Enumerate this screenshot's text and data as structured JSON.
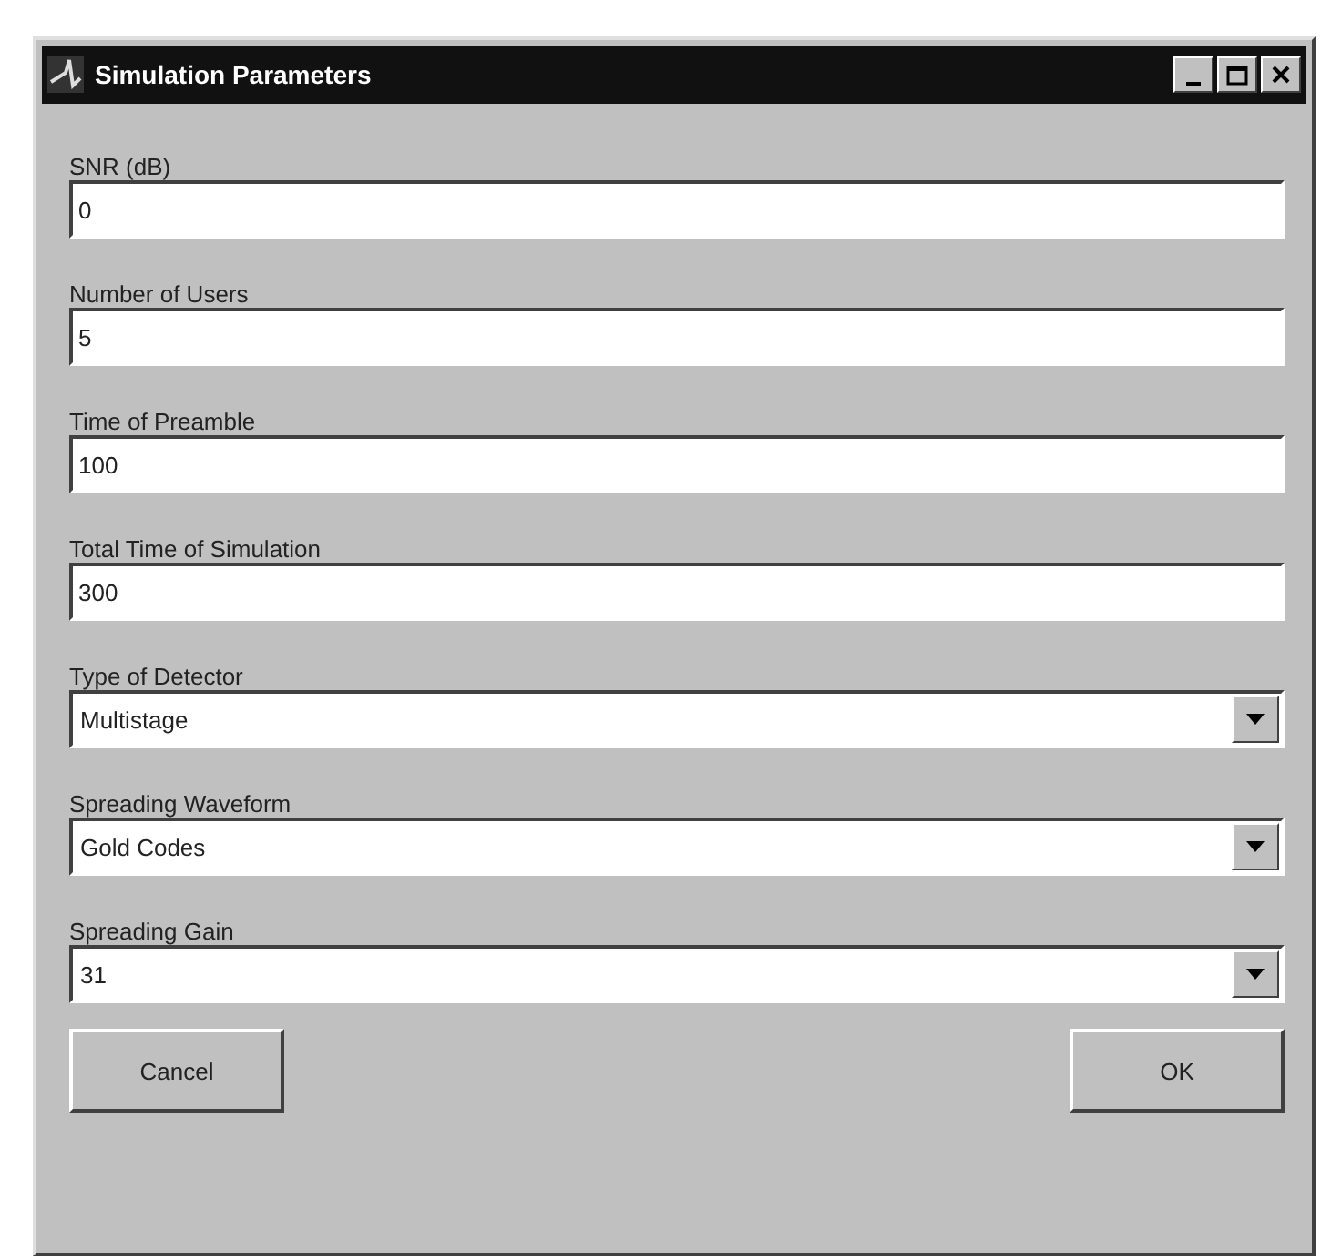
{
  "window": {
    "title": "Simulation Parameters"
  },
  "fields": [
    {
      "kind": "text",
      "label": "SNR (dB)",
      "value": "0"
    },
    {
      "kind": "text",
      "label": "Number of Users",
      "value": "5"
    },
    {
      "kind": "text",
      "label": "Time of Preamble",
      "value": "100"
    },
    {
      "kind": "text",
      "label": "Total Time of Simulation",
      "value": "300"
    },
    {
      "kind": "dropdown",
      "label": "Type of Detector",
      "value": "Multistage"
    },
    {
      "kind": "dropdown",
      "label": "Spreading Waveform",
      "value": "Gold Codes"
    },
    {
      "kind": "dropdown",
      "label": "Spreading Gain",
      "value": "31"
    }
  ],
  "buttons": [
    {
      "label": "Cancel"
    },
    {
      "label": "OK"
    }
  ]
}
